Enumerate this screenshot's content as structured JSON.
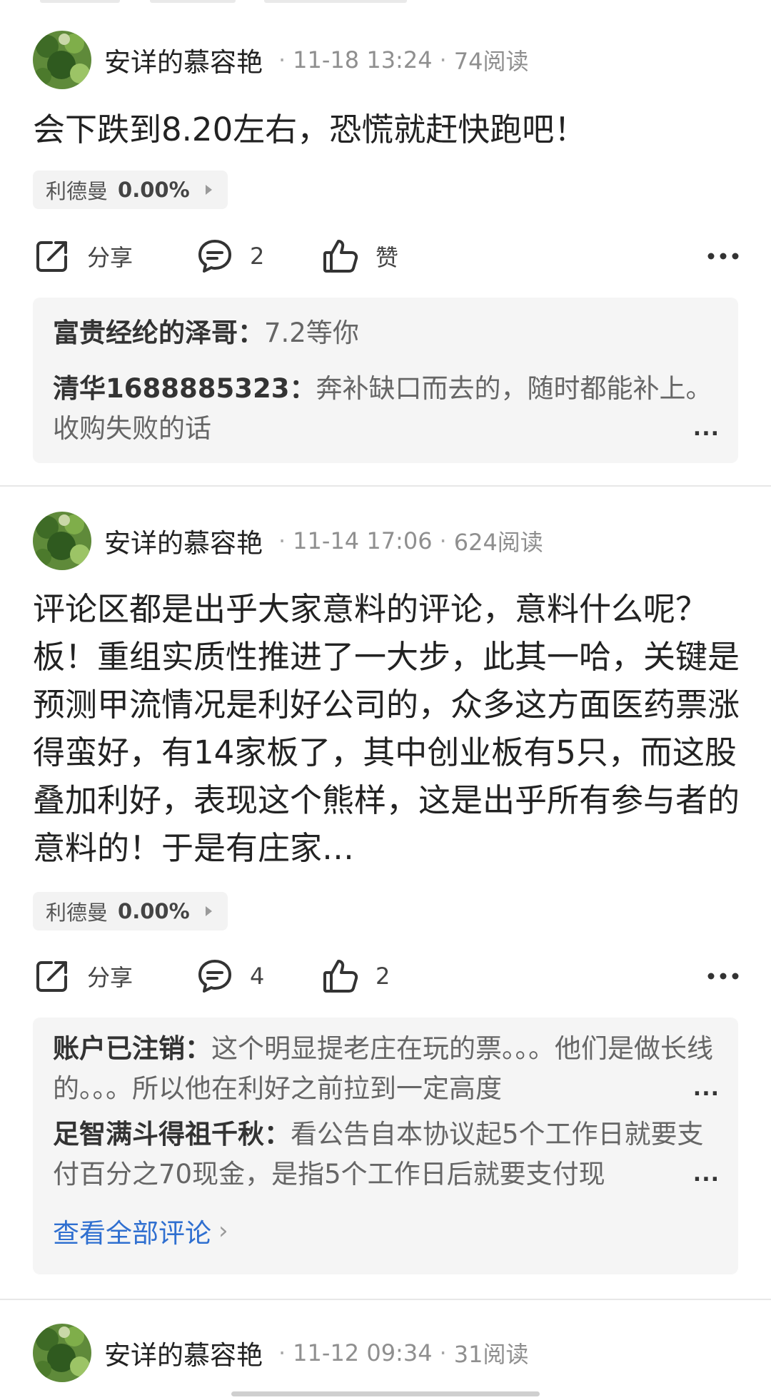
{
  "posts": [
    {
      "author": "安详的慕容艳",
      "time": "11-18 13:24",
      "reads": "74阅读",
      "text": "会下跌到8.20左右，恐慌就赶快跑吧！",
      "stock": {
        "name": "利德曼",
        "change": "0.00%"
      },
      "actions": {
        "share": "分享",
        "comments": "2",
        "likes": "赞"
      },
      "comments": [
        {
          "name": "富贵经纶的泽哥：",
          "text": "7.2等你"
        },
        {
          "name": "清华1688885323：",
          "text": "奔补缺口而去的，随时都能补上。收购失败的话"
        }
      ]
    },
    {
      "author": "安详的慕容艳",
      "time": "11-14 17:06",
      "reads": "624阅读",
      "text": "评论区都是出乎大家意料的评论，意料什么呢？板！重组实质性推进了一大步，此其一哈，关键是预测甲流情况是利好公司的，众多这方面医药票涨得蛮好，有14家板了，其中创业板有5只，而这股叠加利好，表现这个熊样，这是出乎所有参与者的意料的！于是有庄家…",
      "stock": {
        "name": "利德曼",
        "change": "0.00%"
      },
      "actions": {
        "share": "分享",
        "comments": "4",
        "likes": "2"
      },
      "comments": [
        {
          "name": "账户已注销：",
          "text": "这个明显提老庄在玩的票。。。他们是做长线的。。。所以他在利好之前拉到一定高度"
        },
        {
          "name": "足智满斗得祖千秋：",
          "text": "看公告自本协议起5个工作日就要支付百分之70现金，是指5个工作日后就要支付现"
        }
      ],
      "view_all": "查看全部评论"
    },
    {
      "author": "安详的慕容艳",
      "time": "11-12 09:34",
      "reads": "31阅读"
    }
  ],
  "ellipsis": "...",
  "more_glyph": "•••",
  "colors": {
    "link": "#2f6fd0",
    "comment_bg": "#f5f5f5",
    "tag_bg": "#f3f3f3"
  }
}
